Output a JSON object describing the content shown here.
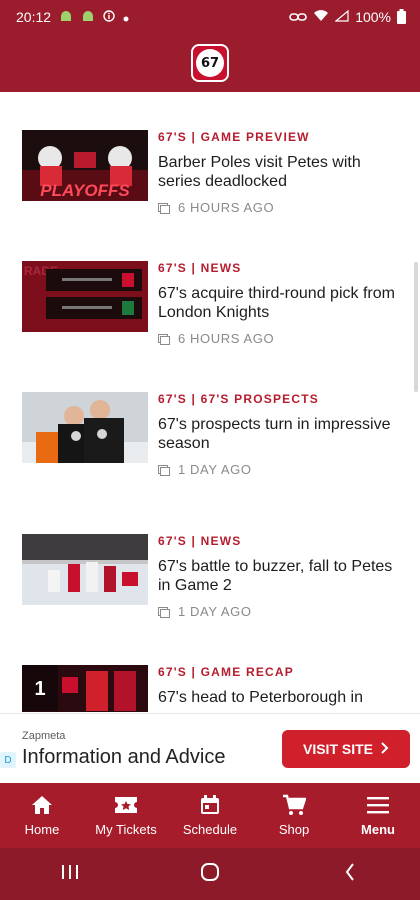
{
  "status": {
    "time": "20:12",
    "battery": "100%"
  },
  "colors": {
    "brand": "#9b1c2c",
    "accent": "#b51d2e",
    "ad_button": "#d0202b"
  },
  "articles": [
    {
      "category": "67's | Game Preview",
      "headline": "Barber Poles visit Petes with series deadlocked",
      "time": "6 HOURS AGO",
      "thumb_text": "PLAYOFFS"
    },
    {
      "category": "67's | News",
      "headline": "67's acquire third-round pick from London Knights",
      "time": "6 HOURS AGO",
      "thumb_text": "RADE"
    },
    {
      "category": "67's | 67's Prospects",
      "headline": "67's prospects turn in impressive season",
      "time": "1 DAY AGO"
    },
    {
      "category": "67's | News",
      "headline": "67's battle to buzzer, fall to Petes in Game 2",
      "time": "1 DAY AGO"
    },
    {
      "category": "67's | Game Recap",
      "headline": "67's head to Peterborough in",
      "thumb_text": "1"
    }
  ],
  "ad": {
    "provider": "Zapmeta",
    "title": "Information and Advice",
    "button": "VISIT SITE",
    "badge": "D"
  },
  "nav": {
    "items": [
      {
        "label": "Home",
        "icon": "home-icon"
      },
      {
        "label": "My Tickets",
        "icon": "ticket-icon"
      },
      {
        "label": "Schedule",
        "icon": "calendar-icon"
      },
      {
        "label": "Shop",
        "icon": "cart-icon"
      },
      {
        "label": "Menu",
        "icon": "menu-icon"
      }
    ]
  },
  "logo_text": "67"
}
